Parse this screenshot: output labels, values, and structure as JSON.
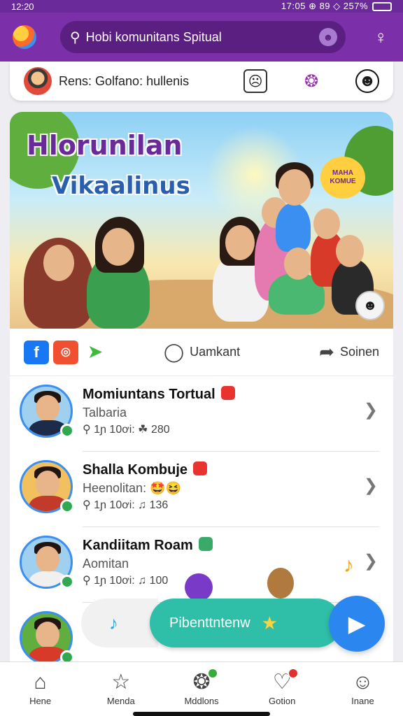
{
  "status_bar": {
    "time": "12:20",
    "right_text": "17:05 ⊕ 89 ◇ 257%"
  },
  "app": {
    "search_text": "Hobi komunitans Spitual",
    "search_icon": "search-icon",
    "voice_icon": "mic-icon",
    "profile_icon": "person-icon"
  },
  "top_card": {
    "caption": "Rens: Golfano: hullenis"
  },
  "hero": {
    "title_line1": "Hlorunilan",
    "title_line2": "Vikaalinus",
    "speech_bubble": "MAHA KOMUE"
  },
  "actions": {
    "comment_label": "Uamkant",
    "share_label": "Soinen"
  },
  "list": [
    {
      "name": "Momiuntans Tortual",
      "sub": "Talbaria",
      "meta": "1ɲ 10ơi: ☘ 280",
      "badge_color": "#e8332f"
    },
    {
      "name": "Shalla Kombuje",
      "sub": "Heenolitan: 🤩😆",
      "meta": "1ɲ 10ơi: ♫ 136",
      "badge_color": "#e8332f"
    },
    {
      "name": "Kandiitam Roam",
      "sub": "Aomitan",
      "meta": "1ɲ 10ơi: ♫ 100",
      "badge_color": "#3aaa6a"
    }
  ],
  "floating": {
    "pill_label": "Pibenttntenw"
  },
  "bottom_nav": [
    {
      "label": "Hene",
      "icon": "home-icon"
    },
    {
      "label": "Menda",
      "icon": "star-icon"
    },
    {
      "label": "Mddlons",
      "icon": "cookie-icon"
    },
    {
      "label": "Gotion",
      "icon": "heart-icon"
    },
    {
      "label": "Inane",
      "icon": "person-icon"
    }
  ],
  "colors": {
    "brand_purple": "#7b2fa8",
    "accent_teal": "#2fbfa8",
    "send_blue": "#2b86f0"
  }
}
